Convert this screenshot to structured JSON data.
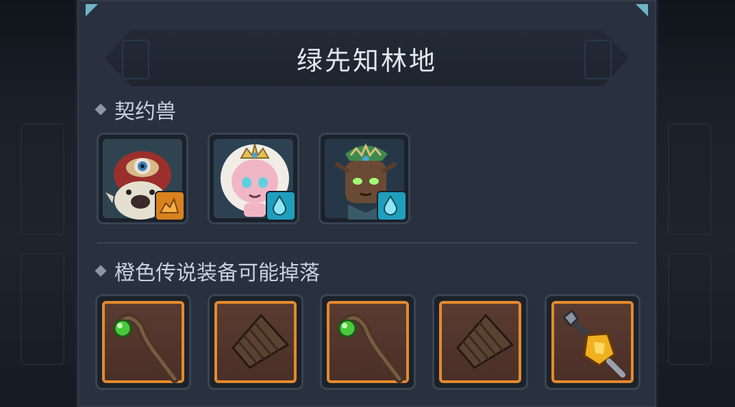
{
  "title": "绿先知林地",
  "sections": {
    "pets_label": "契约兽",
    "drops_label": "橙色传说装备可能掉落"
  },
  "pets": [
    {
      "name": "cyclops-beast",
      "element": "earth",
      "element_icon": "earth-element-icon"
    },
    {
      "name": "fluffy-princess",
      "element": "water",
      "element_icon": "water-drop-icon"
    },
    {
      "name": "tree-guardian",
      "element": "water",
      "element_icon": "water-drop-icon"
    }
  ],
  "drops": [
    {
      "type": "staff",
      "icon": "staff-icon",
      "rarity": "legendary"
    },
    {
      "type": "bracer",
      "icon": "bracer-icon",
      "rarity": "legendary"
    },
    {
      "type": "staff",
      "icon": "staff-icon",
      "rarity": "legendary"
    },
    {
      "type": "bracer",
      "icon": "bracer-icon",
      "rarity": "legendary"
    },
    {
      "type": "amulet",
      "icon": "amulet-icon",
      "rarity": "legendary"
    }
  ],
  "colors": {
    "panel": "#29313f",
    "legendary_border": "#e48a2c",
    "earth_badge": "#d9821e",
    "water_badge": "#1f9fbd",
    "accent_corner": "#6fb3c8"
  }
}
